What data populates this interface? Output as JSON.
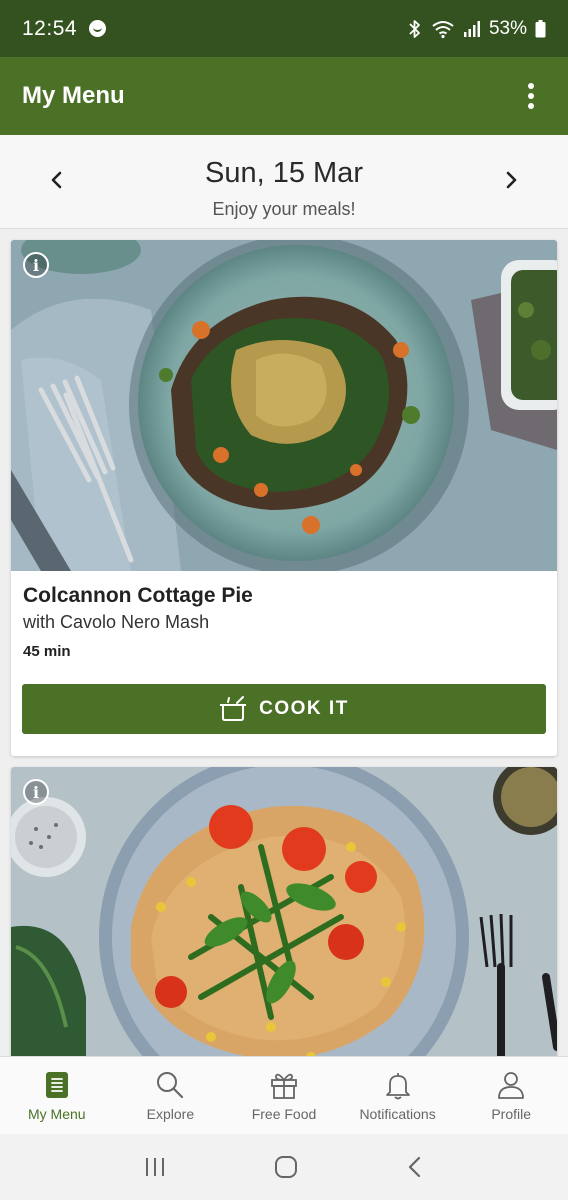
{
  "status_bar": {
    "time": "12:54",
    "battery": "53%"
  },
  "app_bar": {
    "title": "My Menu"
  },
  "date_header": {
    "date": "Sun, 15 Mar",
    "subtitle": "Enjoy your meals!"
  },
  "recipes": [
    {
      "title": "Colcannon Cottage Pie",
      "subtitle": "with Cavolo Nero Mash",
      "time": "45 min",
      "action_label": "COOK IT"
    }
  ],
  "bottom_nav": {
    "items": [
      {
        "label": "My Menu",
        "icon": "menu-list-icon",
        "active": true
      },
      {
        "label": "Explore",
        "icon": "search-icon",
        "active": false
      },
      {
        "label": "Free Food",
        "icon": "gift-icon",
        "active": false
      },
      {
        "label": "Notifications",
        "icon": "bell-icon",
        "active": false
      },
      {
        "label": "Profile",
        "icon": "person-icon",
        "active": false
      }
    ]
  },
  "colors": {
    "status_bar": "#345220",
    "brand": "#4b7127",
    "background": "#efefef"
  }
}
